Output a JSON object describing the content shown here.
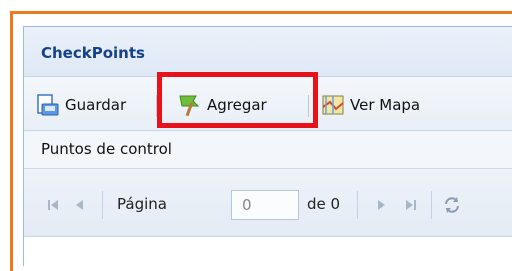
{
  "panel": {
    "title": "CheckPoints"
  },
  "toolbar": {
    "buttons": [
      {
        "label": "Guardar",
        "icon": "save-icon"
      },
      {
        "label": "Agregar",
        "icon": "flag-add-icon"
      },
      {
        "label": "Ver Mapa",
        "icon": "map-icon"
      }
    ]
  },
  "grid": {
    "header": "Puntos de control"
  },
  "paging": {
    "page_label": "Página",
    "page_value": "0",
    "of_label": "de 0"
  },
  "colors": {
    "frame": "#f07a1e",
    "highlight": "#e8131a",
    "title": "#15428b"
  }
}
